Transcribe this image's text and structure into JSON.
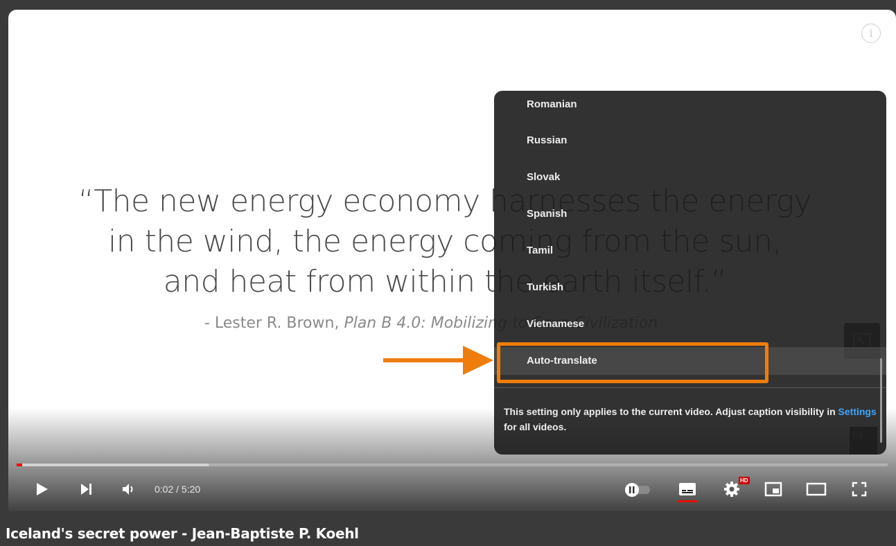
{
  "slide": {
    "quote_lines": [
      "“The new energy economy harnesses the energy",
      "in the wind, the energy coming from the sun,",
      "and heat from within the earth itself.”"
    ],
    "attribution_prefix": "- Lester R. Brown, ",
    "attribution_book": "Plan B 4.0: Mobilizing to Save Civilization"
  },
  "caption_menu": {
    "languages": [
      "Romanian",
      "Russian",
      "Slovak",
      "Spanish",
      "Tamil",
      "Turkish",
      "Vietnamese"
    ],
    "auto_translate_label": "Auto-translate",
    "note_before_link": "This setting only applies to the current video. Adjust caption visibility in ",
    "note_link": "Settings",
    "note_after_link": " for all videos."
  },
  "controls": {
    "time": "0:02 / 5:20",
    "hd_badge": "HD",
    "played_fraction": 0.006,
    "buffered_fraction": 0.22
  },
  "side_widget_text": "Ed",
  "video_title": "Iceland's secret power - Jean-Baptiste P. Koehl",
  "info_icon_glyph": "i",
  "colors": {
    "annotation": "#ef7d0c",
    "progress": "#ff0000",
    "link": "#3ea6ff"
  }
}
